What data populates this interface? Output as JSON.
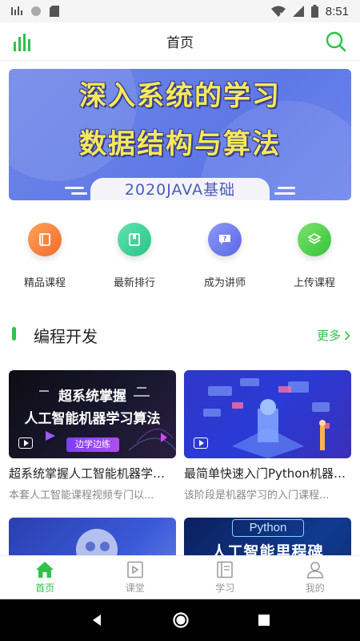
{
  "status_bar": {
    "time": "8:51"
  },
  "app_bar": {
    "title": "首页"
  },
  "banner": {
    "line1": "深入系统的学习",
    "line2": "数据结构与算法",
    "subtitle": "2020JAVA基础"
  },
  "categories": [
    {
      "label": "精品课程",
      "icon": "book-icon",
      "color": "#f7873a"
    },
    {
      "label": "最新排行",
      "icon": "ranking-icon",
      "color": "#3fd39a"
    },
    {
      "label": "成为讲师",
      "icon": "lecturer-icon",
      "color": "#6f7cf0"
    },
    {
      "label": "上传课程",
      "icon": "layers-icon",
      "color": "#4fcf4a"
    }
  ],
  "section": {
    "title": "编程开发",
    "more": "更多"
  },
  "courses": [
    {
      "image_line1": "超系统掌握",
      "image_line2": "人工智能机器学习算法",
      "image_tag": "边学边练",
      "title": "超系统掌握人工智能机器学习算法",
      "desc": "本套人工智能课程视频专门以..."
    },
    {
      "image_line1": "",
      "title": "最简单快速入门Python机器学习",
      "desc": "该阶段是机器学习的入门课程..."
    },
    {
      "image_line1": "",
      "title": "",
      "desc": ""
    },
    {
      "image_line1": "Python",
      "image_line2": "人工智能里程碑",
      "title": "",
      "desc": ""
    }
  ],
  "bottom_nav": [
    {
      "label": "首页",
      "icon": "home-icon",
      "active": true
    },
    {
      "label": "课堂",
      "icon": "classroom-icon",
      "active": false
    },
    {
      "label": "学习",
      "icon": "study-icon",
      "active": false
    },
    {
      "label": "我的",
      "icon": "profile-icon",
      "active": false
    }
  ],
  "colors": {
    "accent": "#2ec24a",
    "banner": "#6f86e8",
    "muted": "#999999"
  }
}
